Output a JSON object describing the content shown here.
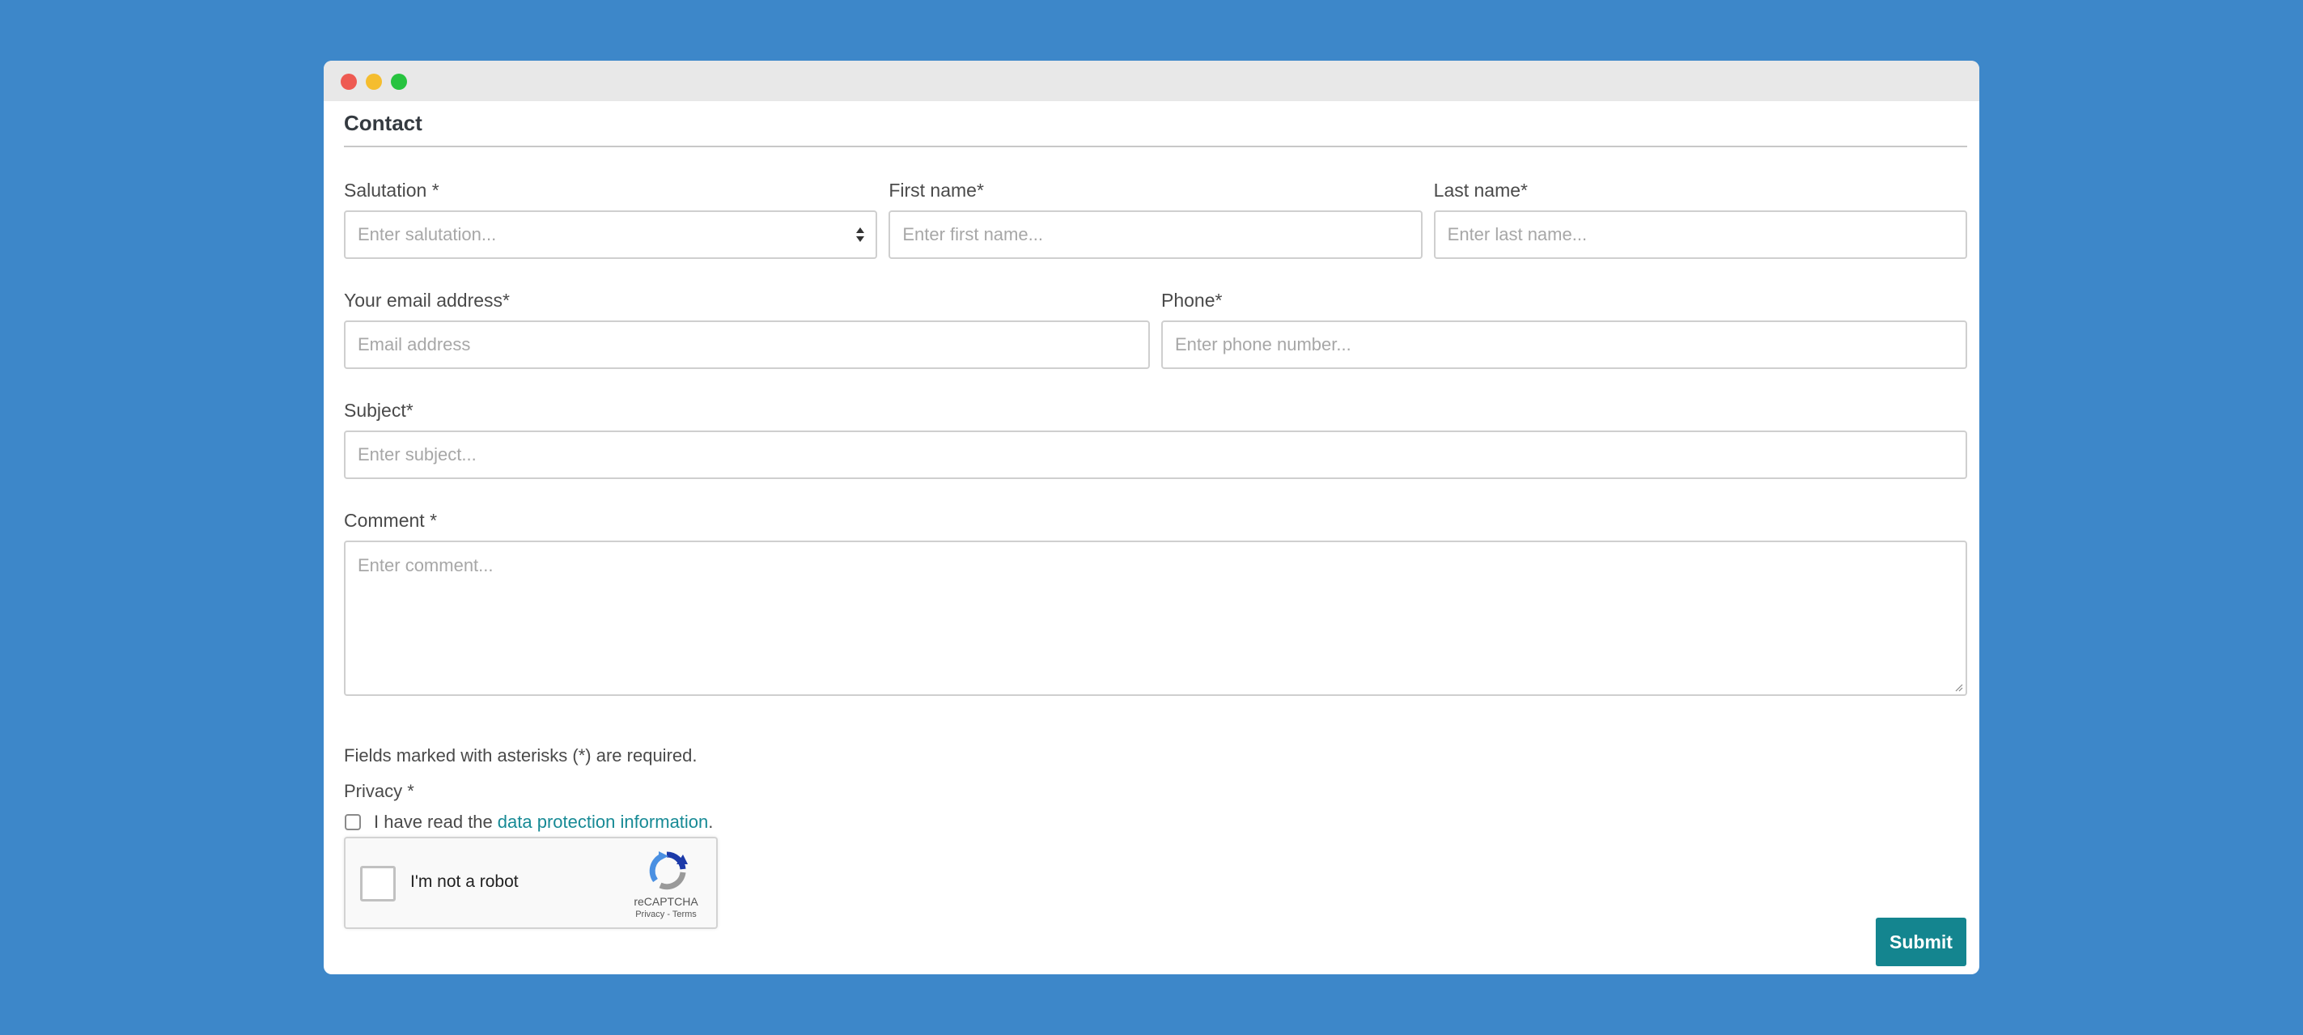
{
  "window": {
    "controls": [
      "close",
      "minimize",
      "maximize"
    ]
  },
  "form": {
    "title": "Contact",
    "salutation": {
      "label": "Salutation *",
      "placeholder": "Enter salutation..."
    },
    "first_name": {
      "label": "First name*",
      "placeholder": "Enter first name..."
    },
    "last_name": {
      "label": "Last name*",
      "placeholder": "Enter last name..."
    },
    "email": {
      "label": "Your email address*",
      "placeholder": "Email address"
    },
    "phone": {
      "label": "Phone*",
      "placeholder": "Enter phone number..."
    },
    "subject": {
      "label": "Subject*",
      "placeholder": "Enter subject..."
    },
    "comment": {
      "label": "Comment *",
      "placeholder": "Enter comment..."
    },
    "required_note": "Fields marked with asterisks (*) are required.",
    "privacy": {
      "label": "Privacy *",
      "checkbox_text": "I have read the",
      "link_text": "data protection information",
      "suffix": ".",
      "checked": false
    },
    "recaptcha": {
      "label": "I'm not a robot",
      "brand": "reCAPTCHA",
      "links": "Privacy - Terms",
      "checked": false
    },
    "submit_label": "Submit"
  },
  "colors": {
    "background": "#3d87c9",
    "accent": "#14858f",
    "link": "#178a95"
  }
}
